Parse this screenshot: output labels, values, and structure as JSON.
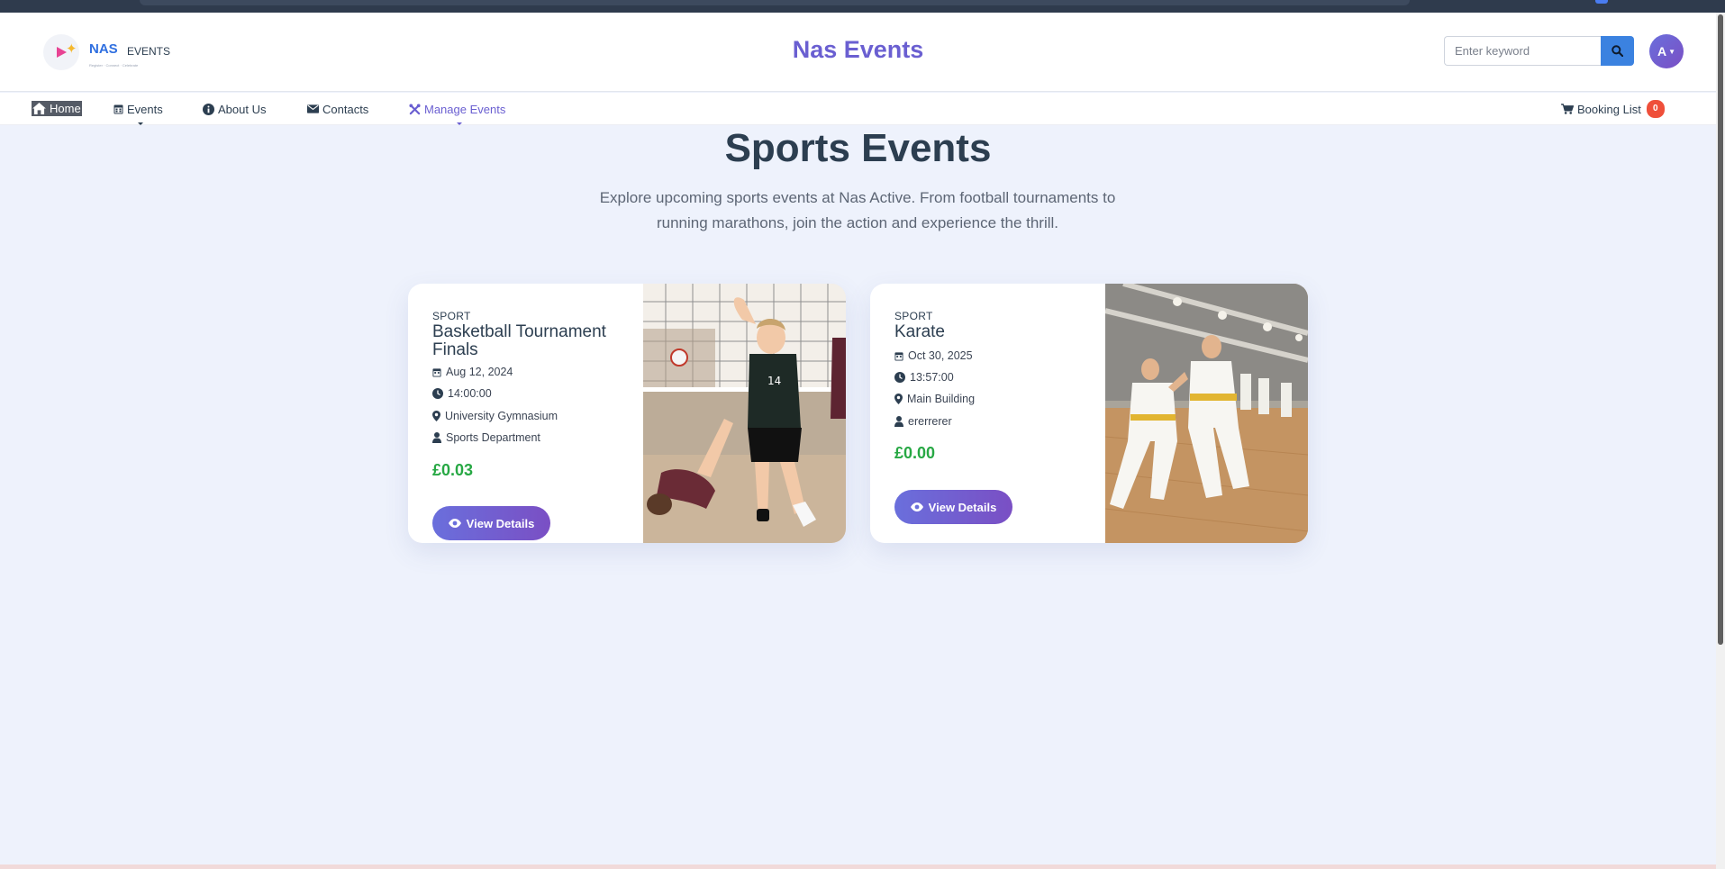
{
  "header": {
    "logo": {
      "brand": "NAS",
      "word": "EVENTS",
      "tagline": "Register · Connect · Celebrate"
    },
    "site_title": "Nas Events",
    "search": {
      "placeholder": "Enter keyword",
      "icon": "search-icon"
    },
    "avatar_initial": "A"
  },
  "nav": {
    "items": [
      {
        "label": "Home",
        "icon": "home-icon"
      },
      {
        "label": "Events",
        "icon": "calendar-icon"
      },
      {
        "label": "About Us",
        "icon": "info-icon"
      },
      {
        "label": "Contacts",
        "icon": "envelope-icon"
      },
      {
        "label": "Manage Events",
        "icon": "tools-icon"
      }
    ],
    "cart": {
      "label": "Booking List",
      "count": "0",
      "icon": "cart-icon"
    }
  },
  "hero": {
    "title": "Sports Events",
    "subtitle": "Explore upcoming sports events at Nas Active. From football tournaments to running marathons, join the action and experience the thrill."
  },
  "events": [
    {
      "category": "SPORT",
      "title": "Basketball Tournament Finals",
      "date": "Aug 12, 2024",
      "time": "14:00:00",
      "location": "University Gymnasium",
      "organizer": "Sports Department",
      "price": "£0.03",
      "button": "View Details",
      "image": "volleyball-photo"
    },
    {
      "category": "SPORT",
      "title": "Karate",
      "date": "Oct 30, 2025",
      "time": "13:57:00",
      "location": "Main Building",
      "organizer": "ererrerer",
      "price": "£0.00",
      "button": "View Details",
      "image": "karate-photo"
    }
  ],
  "colors": {
    "accent": "#6a5fd1",
    "price": "#27a844",
    "badge": "#ef4f3a",
    "page_bg": "#eef2fc"
  }
}
